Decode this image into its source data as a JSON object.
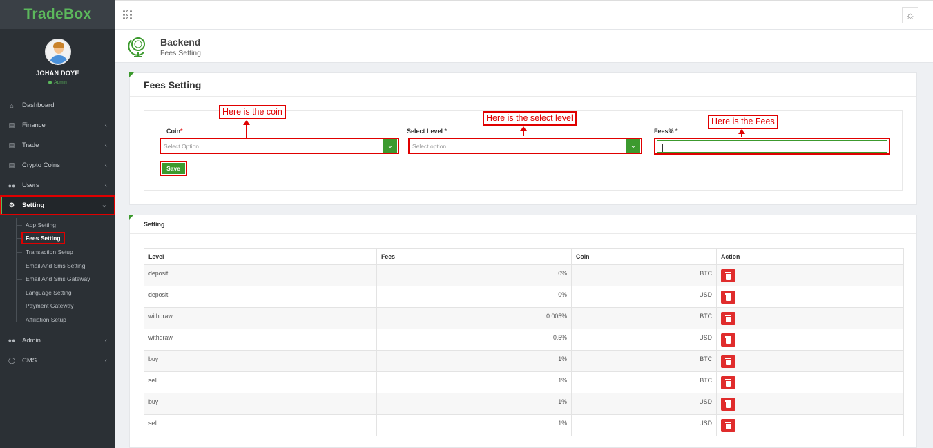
{
  "app": {
    "brand": "TradeBox"
  },
  "user": {
    "name": "JOHAN DOYE",
    "role": "Admin"
  },
  "sidebar": {
    "items": [
      {
        "label": "Dashboard",
        "icon": "home-icon"
      },
      {
        "label": "Finance",
        "icon": "card-icon"
      },
      {
        "label": "Trade",
        "icon": "card-icon"
      },
      {
        "label": "Crypto Coins",
        "icon": "card-icon"
      },
      {
        "label": "Users",
        "icon": "users-icon"
      },
      {
        "label": "Setting",
        "icon": "gear-icon"
      }
    ],
    "setting_sub": [
      "App Setting",
      "Fees Setting",
      "Transaction Setup",
      "Email And Sms Setting",
      "Email And Sms Gateway",
      "Language Setting",
      "Payment Gateway",
      "Affiliation Setup"
    ],
    "lower_items": [
      {
        "label": "Admin",
        "icon": "users-icon"
      },
      {
        "label": "CMS",
        "icon": "pin-icon"
      }
    ]
  },
  "page_header": {
    "title": "Backend",
    "subtitle": "Fees Setting"
  },
  "form_panel": {
    "title": "Fees Setting",
    "coin_label": "Coin",
    "coin_placeholder": "Select Option",
    "level_label": "Select Level *",
    "level_placeholder": "Select option",
    "fees_label": "Fees% *",
    "fees_value": "",
    "save_label": "Save"
  },
  "annotations": {
    "coin": "Here is the coin",
    "level": "Here is the select level",
    "fees": "Here is the Fees"
  },
  "table_panel": {
    "title": "Setting",
    "headers": [
      "Level",
      "Fees",
      "Coin",
      "Action"
    ],
    "rows": [
      {
        "level": "deposit",
        "fees": "0%",
        "coin": "BTC"
      },
      {
        "level": "deposit",
        "fees": "0%",
        "coin": "USD"
      },
      {
        "level": "withdraw",
        "fees": "0.005%",
        "coin": "BTC"
      },
      {
        "level": "withdraw",
        "fees": "0.5%",
        "coin": "USD"
      },
      {
        "level": "buy",
        "fees": "1%",
        "coin": "BTC"
      },
      {
        "level": "sell",
        "fees": "1%",
        "coin": "BTC"
      },
      {
        "level": "buy",
        "fees": "1%",
        "coin": "USD"
      },
      {
        "level": "sell",
        "fees": "1%",
        "coin": "USD"
      }
    ]
  },
  "colors": {
    "accent": "#3c9a2e",
    "highlight": "#e00000",
    "danger": "#e02c2c",
    "sidebar": "#2b3035"
  }
}
